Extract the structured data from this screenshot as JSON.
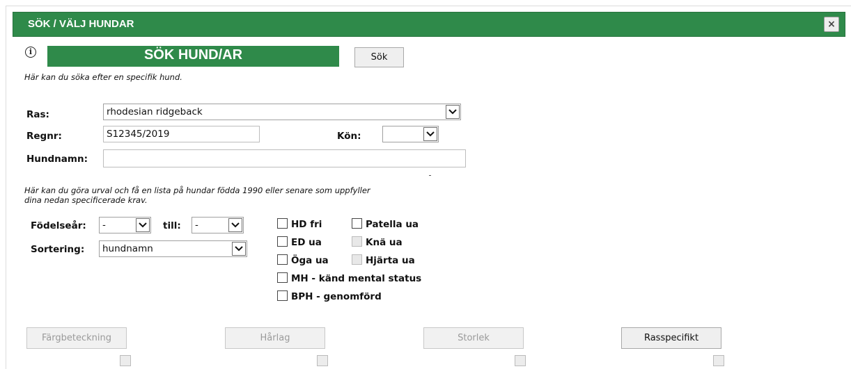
{
  "dialog": {
    "title": "SÖK / VÄLJ HUNDAR",
    "close_label": "×"
  },
  "banner": {
    "title": "SÖK HUND/AR",
    "info_icon": "i"
  },
  "search_button": "Sök",
  "hint_specific": "Här kan du söka efter en specifik hund.",
  "form": {
    "ras_label": "Ras:",
    "ras_value": "rhodesian ridgeback",
    "regnr_label": "Regnr:",
    "regnr_value": "S12345/2019",
    "kon_label": "Kön:",
    "kon_value": "",
    "hundnamn_label": "Hundnamn:",
    "hundnamn_value": ""
  },
  "hint_filter_line1": "Här kan du göra urval och få en lista på hundar födda 1990 eller senare som uppfyller",
  "hint_filter_line2": "dina nedan specificerade krav.",
  "filters": {
    "fodelsear_label": "Födelseår:",
    "fodelsear_from": "-",
    "till_label": "till:",
    "fodelsear_to": "-",
    "sortering_label": "Sortering:",
    "sortering_value": "hundnamn"
  },
  "checkboxes": {
    "hd_fri": "HD fri",
    "patella_ua": "Patella ua",
    "ed_ua": "ED ua",
    "kna_ua": "Knä ua",
    "oga_ua": "Öga ua",
    "hjarta_ua": "Hjärta ua",
    "mh": "MH - känd mental status",
    "bph": "BPH - genomförd"
  },
  "bottom_buttons": {
    "fargbeteckning": "Färgbeteckning",
    "harlag": "Hårlag",
    "storlek": "Storlek",
    "rasspecifikt": "Rasspecifikt"
  },
  "icons": {
    "info": "info-circle-icon",
    "close": "close-icon",
    "dropdown": "chevron-down-icon"
  },
  "colors": {
    "header_green": "#2f8a4a"
  }
}
